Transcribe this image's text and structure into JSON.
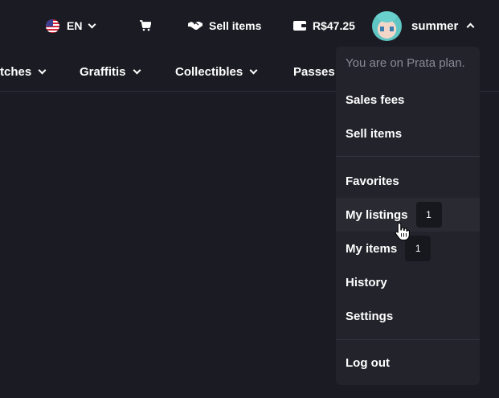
{
  "header": {
    "language": "EN",
    "sell_label": "Sell items",
    "balance": "R$47.25",
    "username": "summer"
  },
  "categories": [
    {
      "label": "tches"
    },
    {
      "label": "Graffitis"
    },
    {
      "label": "Collectibles"
    },
    {
      "label": "Passes"
    }
  ],
  "dropdown": {
    "plan_text": "You are on Prata plan.",
    "items": [
      {
        "label": "Sales fees"
      },
      {
        "label": "Sell items"
      },
      {
        "label": "Favorites"
      },
      {
        "label": "My listings",
        "badge": "1"
      },
      {
        "label": "My items",
        "badge": "1"
      },
      {
        "label": "History"
      },
      {
        "label": "Settings"
      },
      {
        "label": "Log out"
      }
    ]
  },
  "colors": {
    "background": "#1b1b23",
    "dropdown_bg": "#23232c",
    "hover_bg": "#2a2a33",
    "muted_text": "#8a8a96"
  },
  "icons": {
    "language": "us-flag-icon",
    "cart": "cart-icon",
    "sell": "handshake-icon",
    "wallet": "wallet-icon"
  }
}
